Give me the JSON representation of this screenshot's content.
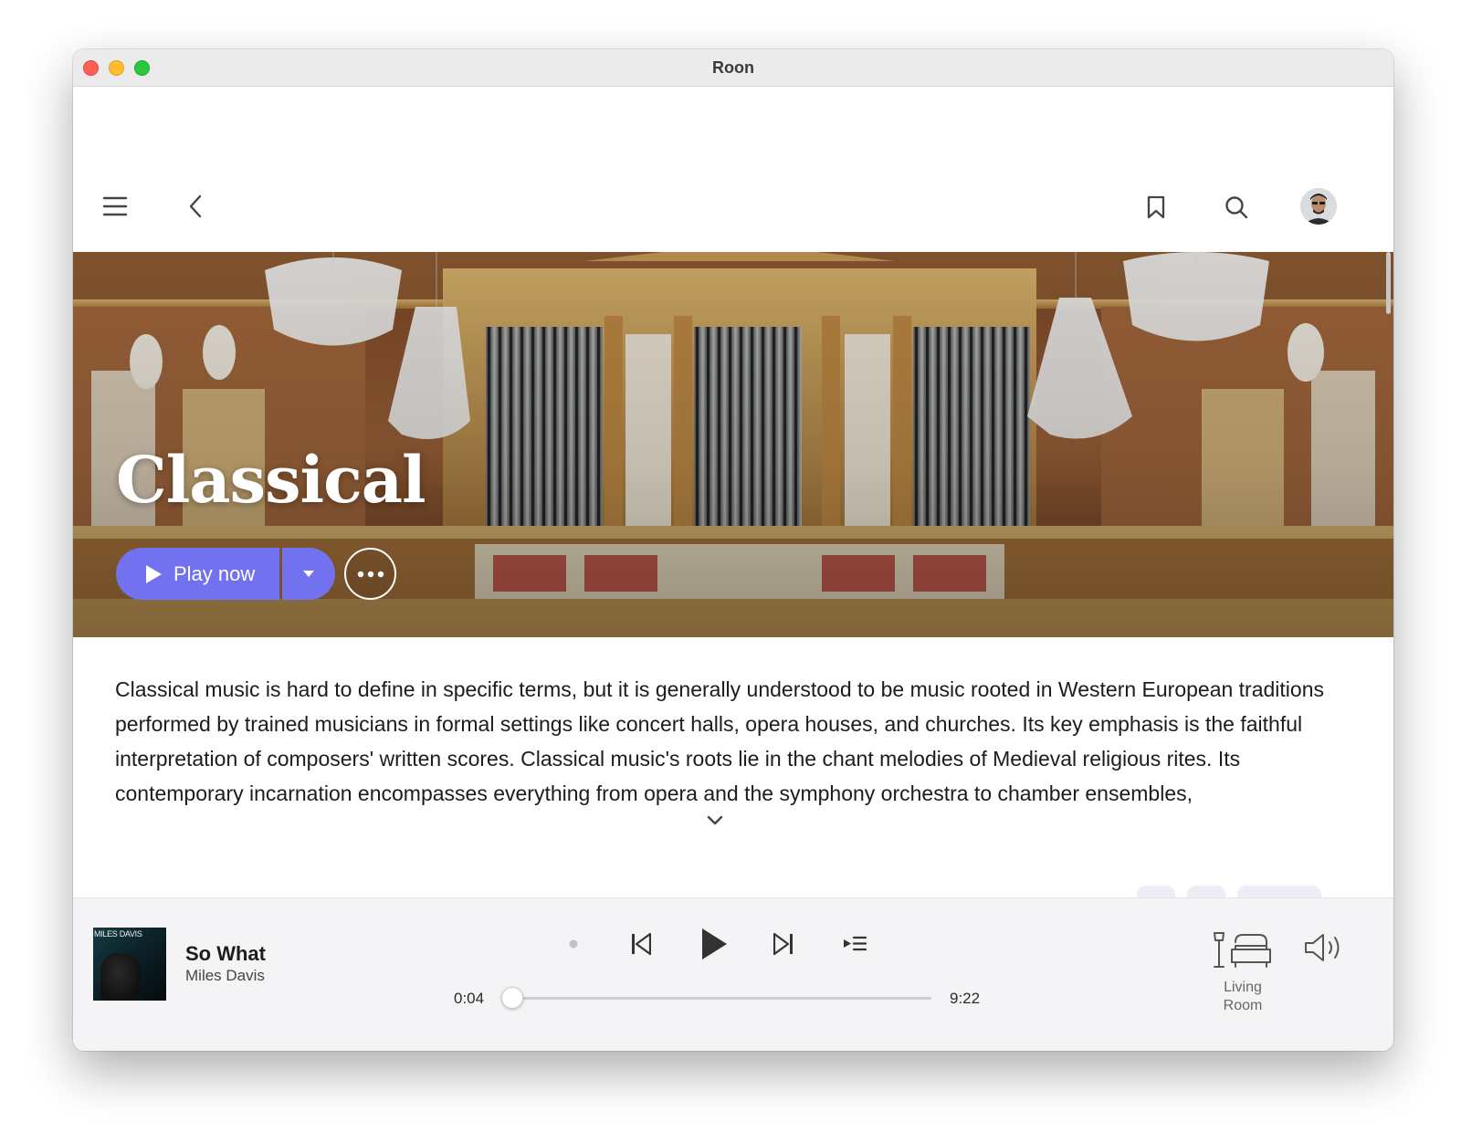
{
  "window": {
    "title": "Roon"
  },
  "nav": {
    "menu_icon": "hamburger-menu-icon",
    "back_icon": "chevron-left-icon",
    "bookmark_icon": "bookmark-icon",
    "search_icon": "search-icon",
    "profile_icon": "user-avatar"
  },
  "hero": {
    "title": "Classical",
    "play_label": "Play now",
    "play_icon": "play-icon",
    "dropdown_icon": "caret-down-icon",
    "more_icon": "ellipsis-icon"
  },
  "description": {
    "text": "Classical music is hard to define in specific terms, but it is generally understood to be music rooted in Western European traditions performed by trained musicians in formal settings like concert halls, opera houses, and churches. Its key emphasis is the faithful interpretation of composers' written scores. Classical music's roots lie in the chant melodies of Medieval religious rites. Its contemporary incarnation encompasses everything from opera and the symphony orchestra to chamber ensembles,",
    "expand_icon": "chevron-down-icon"
  },
  "player": {
    "album_art_text": "MILES DAVIS",
    "track_title": "So What",
    "track_artist": "Miles Davis",
    "elapsed": "0:04",
    "duration": "9:22",
    "progress_fraction": 0.007,
    "zone_line1": "Living",
    "zone_line2": "Room",
    "accent_color": "#7272f0"
  }
}
